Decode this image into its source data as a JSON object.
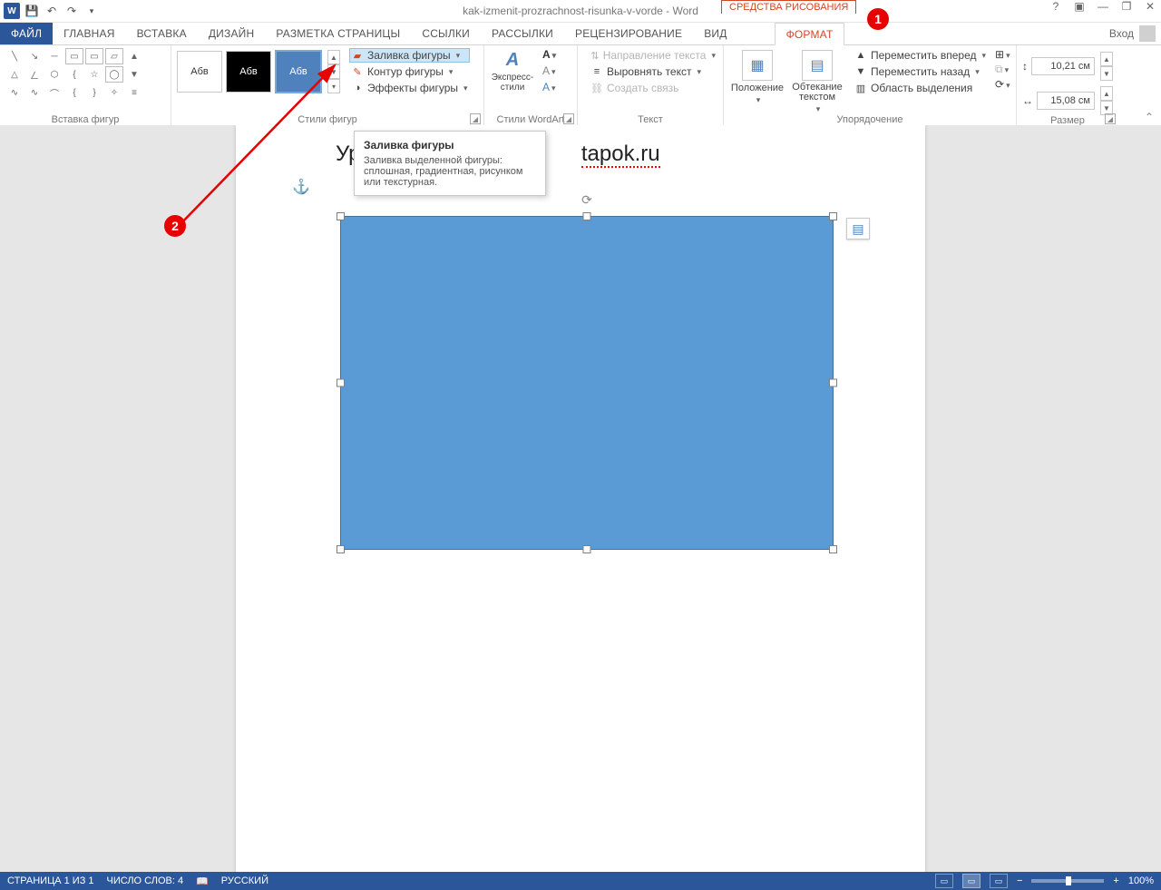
{
  "titlebar": {
    "doc_title": "kak-izmenit-prozrachnost-risunka-v-vorde - Word",
    "tools_context": "СРЕДСТВА РИСОВАНИЯ",
    "login": "Вход"
  },
  "tabs": {
    "file": "ФАЙЛ",
    "home": "ГЛАВНАЯ",
    "insert": "ВСТАВКА",
    "design": "ДИЗАЙН",
    "layout": "РАЗМЕТКА СТРАНИЦЫ",
    "refs": "ССЫЛКИ",
    "mail": "РАССЫЛКИ",
    "review": "РЕЦЕНЗИРОВАНИЕ",
    "view": "ВИД",
    "format": "ФОРМАТ"
  },
  "callouts": {
    "one": "1",
    "two": "2"
  },
  "ribbon": {
    "shapes_group": "Вставка фигур",
    "styles_group": "Стили фигур",
    "styles_swatch": "Абв",
    "fill": "Заливка фигуры",
    "outline": "Контур фигуры",
    "effects": "Эффекты фигуры",
    "wordart_group": "Стили WordArt",
    "wordart_btn": "Экспресс-стили",
    "text_group": "Текст",
    "text_dir": "Направление текста",
    "text_align": "Выровнять текст",
    "text_link": "Создать связь",
    "position": "Положение",
    "wrap": "Обтекание текстом",
    "arrange_group": "Упорядочение",
    "bring": "Переместить вперед",
    "send": "Переместить назад",
    "select": "Область выделения",
    "size_group": "Размер",
    "height": "10,21 см",
    "width": "15,08 см"
  },
  "tooltip": {
    "title": "Заливка фигуры",
    "body": "Заливка выделенной фигуры: сплошная, градиентная, рисунком или текстурная."
  },
  "document": {
    "title_left": "Уро",
    "title_right": "tapok.ru"
  },
  "status": {
    "page": "СТРАНИЦА 1 ИЗ 1",
    "words": "ЧИСЛО СЛОВ: 4",
    "lang": "РУССКИЙ",
    "zoom": "100%"
  }
}
